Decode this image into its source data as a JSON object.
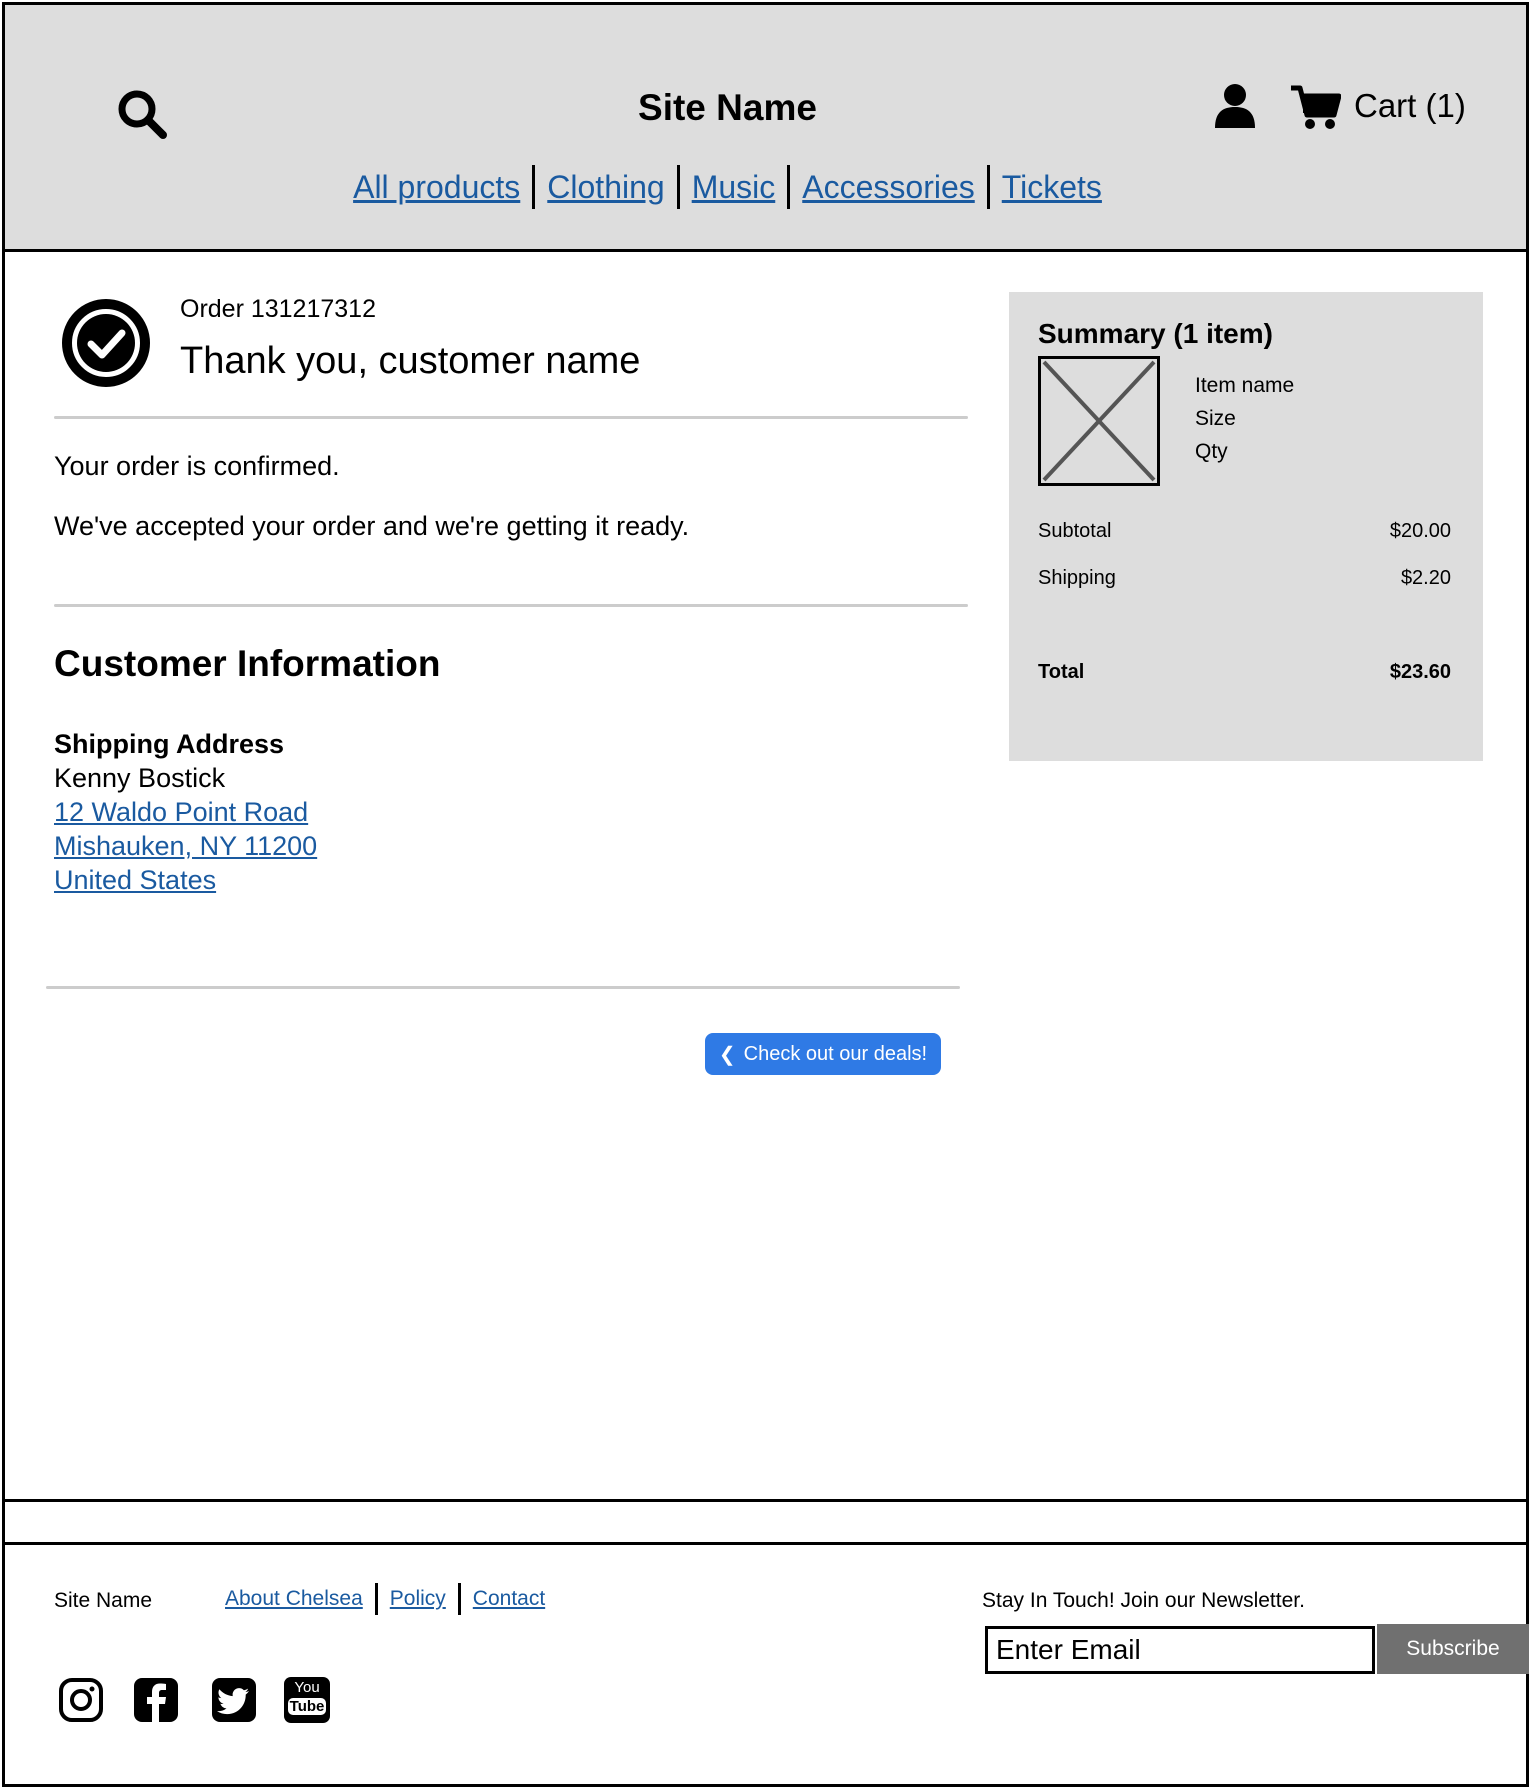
{
  "header": {
    "site_name": "Site Name",
    "cart_label": "Cart (1)",
    "nav": [
      "All products",
      "Clothing",
      "Music",
      "Accessories",
      "Tickets"
    ]
  },
  "order": {
    "number_label": "Order 131217312",
    "thank_you": "Thank you, customer name",
    "confirmed": "Your order is confirmed.",
    "accepted": "We've accepted your order and we're getting it ready."
  },
  "customer": {
    "section_title": "Customer Information",
    "shipping_label": "Shipping Address",
    "name": "Kenny Bostick",
    "address_lines": [
      "12 Waldo Point Road",
      "Mishauken, NY 11200",
      "United States"
    ]
  },
  "deals_button": "Check out our deals!",
  "summary": {
    "title": "Summary (1 item)",
    "item_name": "Item name",
    "size": "Size",
    "qty": "Qty",
    "subtotal_label": "Subtotal",
    "subtotal": "$20.00",
    "shipping_label": "Shipping",
    "shipping": "$2.20",
    "total_label": "Total",
    "total": "$23.60"
  },
  "footer": {
    "site_name": "Site Name",
    "links": [
      "About Chelsea",
      "Policy",
      "Contact"
    ],
    "newsletter_label": "Stay In Touch! Join our Newsletter.",
    "email_placeholder": "Enter Email",
    "subscribe_label": "Subscribe",
    "social_icons": [
      "instagram-icon",
      "facebook-icon",
      "twitter-icon",
      "youtube-icon"
    ],
    "youtube_text": [
      "You",
      "Tube"
    ]
  },
  "colors": {
    "header_bg": "#dddddd",
    "link": "#1a5aa0",
    "button_blue": "#2f7ae5",
    "subscribe_gray": "#707070"
  }
}
